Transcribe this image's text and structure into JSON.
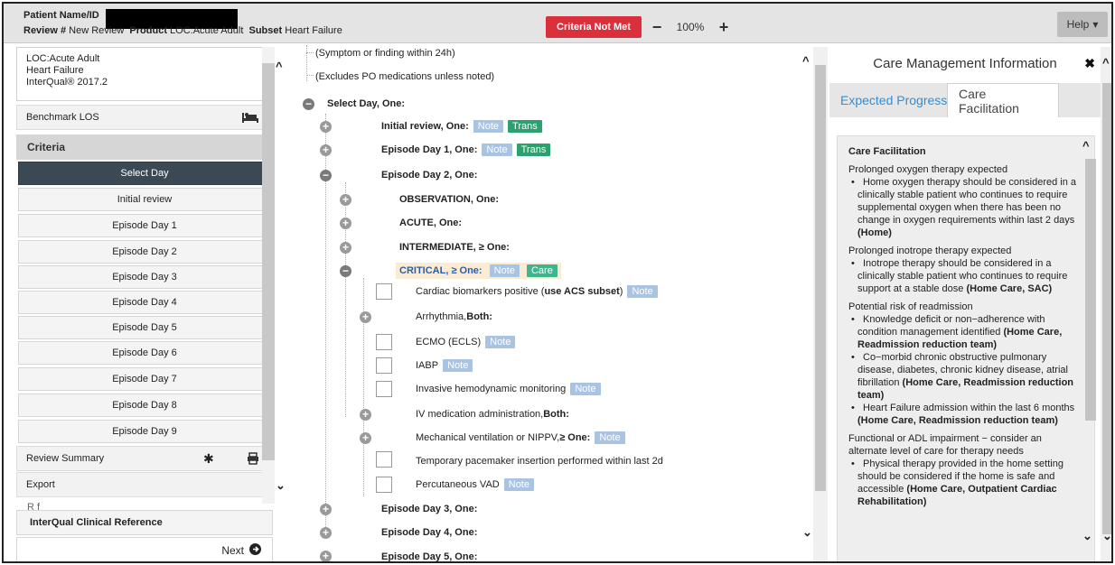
{
  "header": {
    "patient_label": "Patient Name/ID",
    "review_label": "Review #",
    "review_value": "New Review",
    "product_label": "Product",
    "product_value": "LOC:Acute Adult",
    "subset_label": "Subset",
    "subset_value": "Heart Failure",
    "criteria_status": "Criteria Not Met",
    "zoom_minus": "−",
    "zoom_value": "100%",
    "zoom_plus": "+",
    "help_label": "Help",
    "colors": {
      "criteria_status": "#d9303b",
      "active_item": "#3b4954"
    }
  },
  "sidebar": {
    "lob": [
      "LOC:Acute Adult",
      "Heart Failure",
      "InterQual® 2017.2"
    ],
    "benchmark": "Benchmark LOS",
    "criteria_header": "Criteria",
    "days": [
      "Select Day",
      "Initial review",
      "Episode Day 1",
      "Episode Day 2",
      "Episode Day 3",
      "Episode Day 4",
      "Episode Day 5",
      "Episode Day 6",
      "Episode Day 7",
      "Episode Day 8",
      "Episode Day 9"
    ],
    "review_summary": "Review Summary",
    "export": "Export",
    "ref_peek": "R f",
    "clinical_reference": "InterQual Clinical Reference",
    "next": "Next"
  },
  "tree": {
    "line1": "(Symptom or finding within 24h)",
    "line2": "(Excludes PO medications unless noted)",
    "select_day": "Select Day, One:",
    "initial_review": "Initial review, One:",
    "episode_day1": "Episode Day 1, One:",
    "episode_day2": "Episode Day 2, One:",
    "observation": "OBSERVATION, One:",
    "acute": "ACUTE, One:",
    "intermediate": "INTERMEDIATE, ≥ One:",
    "critical": "CRITICAL, ≥ One:",
    "biomarkers_pre": "Cardiac biomarkers positive (",
    "biomarkers_bold": "use ACS subset",
    "biomarkers_post": ")",
    "arrhythmia": "Arrhythmia, ",
    "arrhythmia_bold": "Both:",
    "ecmo": "ECMO (ECLS)",
    "iabp": "IABP",
    "invasive": "Invasive hemodynamic monitoring",
    "iv_med": "IV medication administration, ",
    "iv_med_bold": "Both:",
    "mech_vent": "Mechanical ventilation or NIPPV, ",
    "mech_vent_bold": "≥ One:",
    "temp_pacer": "Temporary pacemaker insertion performed within last 2d",
    "percutaneous": "Percutaneous VAD",
    "episode_day3": "Episode Day 3, One:",
    "episode_day4": "Episode Day 4, One:",
    "episode_day5": "Episode Day 5, One:",
    "note_tag": "Note",
    "trans_tag": "Trans",
    "care_tag": "Care"
  },
  "panel": {
    "title": "Care Management Information",
    "tab_expected": "Expected Progress",
    "tab_facilitation": "Care Facilitation",
    "section_title": "Care Facilitation",
    "g1_title": "Prolonged oxygen therapy expected",
    "g1_b1": "Home oxygen therapy should be considered in a clinically stable patient who continues to require supplemental oxygen when there has been no change in oxygen requirements within last 2 days ",
    "g1_b1_bold": "(Home)",
    "g2_title": "Prolonged inotrope therapy expected",
    "g2_b1": "Inotrope therapy should be considered in a clinically stable patient who continues to require support at a stable dose ",
    "g2_b1_bold": "(Home Care, SAC)",
    "g3_title": "Potential risk of readmission",
    "g3_b1": "Knowledge deficit or non−adherence with condition management identified ",
    "g3_b1_bold": "(Home Care, Readmission reduction team)",
    "g3_b2": "Co−morbid chronic obstructive pulmonary disease, diabetes, chronic kidney disease, atrial fibrillation ",
    "g3_b2_bold": "(Home Care, Readmission reduction team)",
    "g3_b3": "Heart Failure admission within the last 6 months ",
    "g3_b3_bold": "(Home Care, Readmission reduction team)",
    "g4_title": "Functional or ADL impairment − consider an alternate level of care for therapy needs",
    "g4_b1": "Physical therapy provided in the home setting should be considered if the home is safe and accessible ",
    "g4_b1_bold": "(Home Care, Outpatient Cardiac Rehabilitation)"
  }
}
